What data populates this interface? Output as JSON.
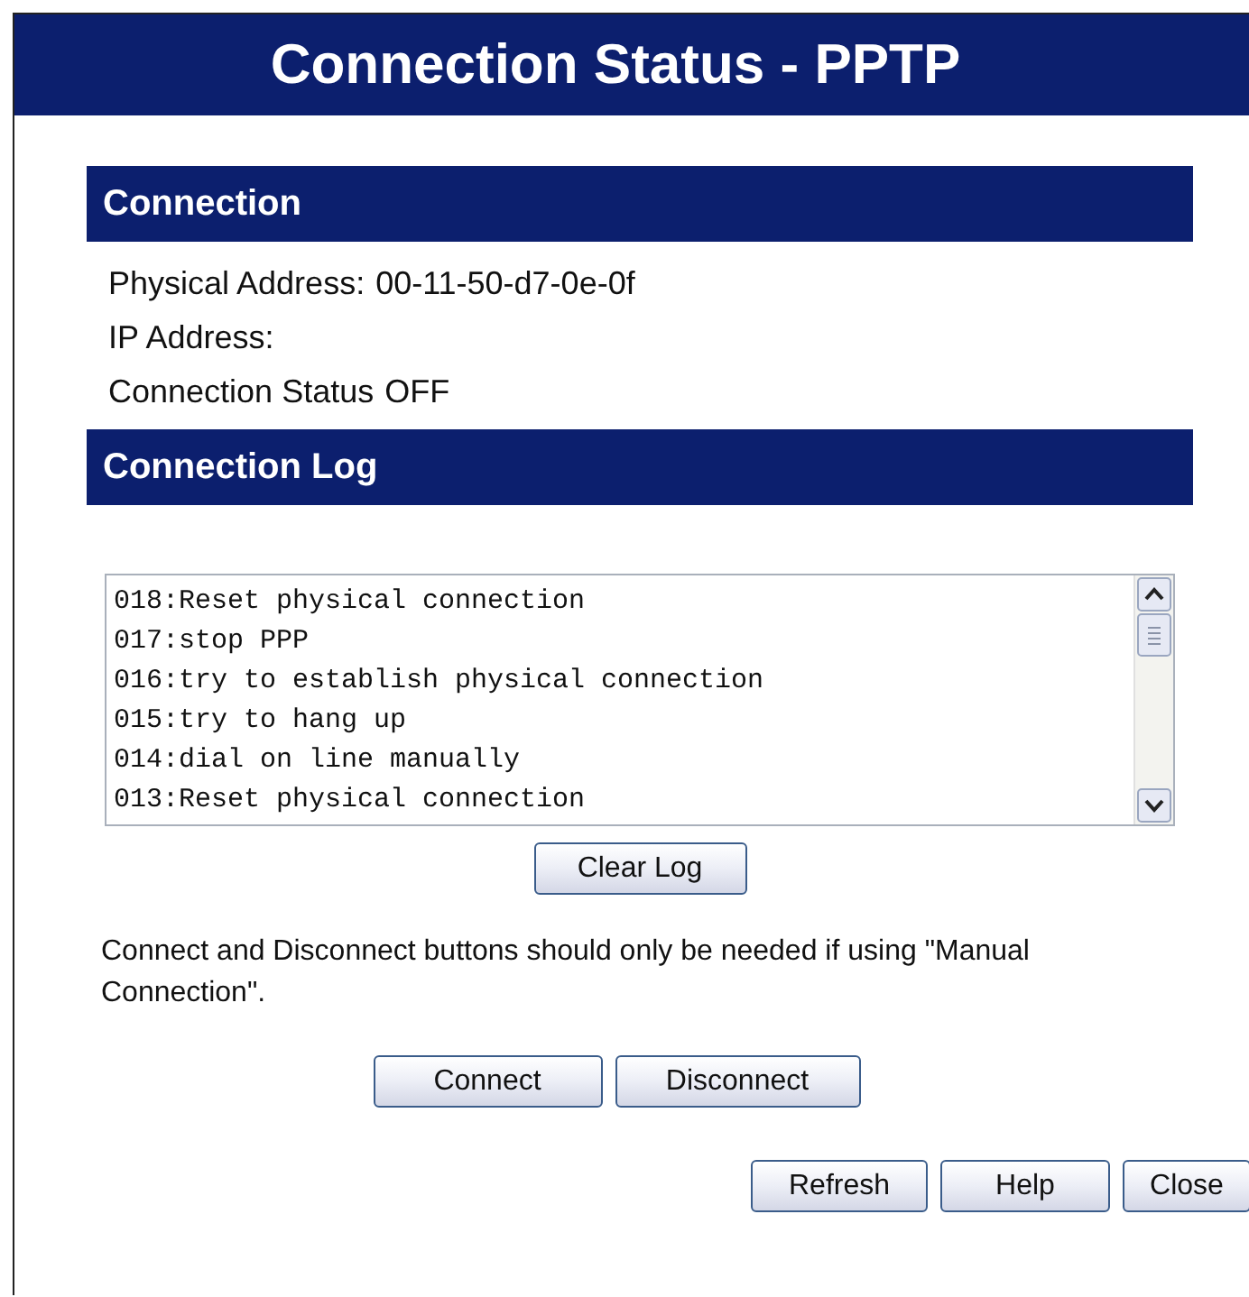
{
  "page_title": "Connection Status - PPTP",
  "connection": {
    "heading": "Connection",
    "fields": [
      {
        "label": "Physical Address:",
        "value": "00-11-50-d7-0e-0f"
      },
      {
        "label": "IP Address:"
      },
      {
        "label": "Connection Status",
        "value": "OFF"
      }
    ]
  },
  "log": {
    "heading": "Connection Log",
    "entries": [
      "018:Reset physical connection",
      "017:stop PPP",
      "016:try to establish physical connection",
      "015:try to hang up",
      "014:dial on line manually",
      "013:Reset physical connection"
    ],
    "clear_button": "Clear Log"
  },
  "note": "Connect and Disconnect buttons should only be needed if using \"Manual Connection\".",
  "connect_buttons": [
    "Connect",
    "Disconnect"
  ],
  "bottom_buttons": [
    "Refresh",
    "Help",
    "Close"
  ]
}
